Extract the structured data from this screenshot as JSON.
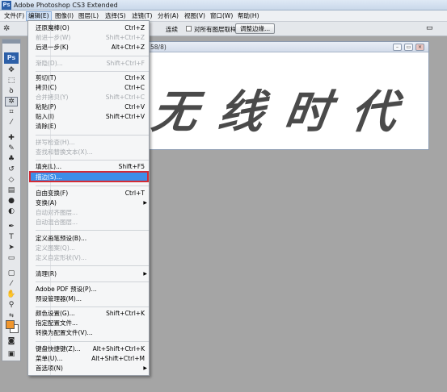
{
  "app": {
    "title": "Adobe Photoshop CS3 Extended",
    "logo": "Ps"
  },
  "menubar": [
    {
      "label": "文件(F)"
    },
    {
      "label": "编辑(E)"
    },
    {
      "label": "图像(I)"
    },
    {
      "label": "图层(L)"
    },
    {
      "label": "选择(S)"
    },
    {
      "label": "滤镜(T)"
    },
    {
      "label": "分析(A)"
    },
    {
      "label": "视图(V)"
    },
    {
      "label": "窗口(W)"
    },
    {
      "label": "帮助(H)"
    }
  ],
  "options_bar": {
    "tool_icon": "magic-wand-icon",
    "text_partial": "连续",
    "all_layers_label": "对所有图层取样",
    "refine_edge_button": "调整边缘..."
  },
  "document": {
    "title_partial": "58/8)",
    "canvas_text": "无线时代",
    "controls": {
      "minimize": "–",
      "restore": "▭",
      "close": "×"
    }
  },
  "edit_menu": {
    "items": [
      {
        "label": "还原魔棒(O)",
        "shortcut": "Ctrl+Z",
        "disabled": false,
        "submenu": false
      },
      {
        "label": "前进一步(W)",
        "shortcut": "Shift+Ctrl+Z",
        "disabled": true,
        "submenu": false
      },
      {
        "label": "后退一步(K)",
        "shortcut": "Alt+Ctrl+Z",
        "disabled": false,
        "submenu": false
      },
      {
        "label": "渐隐(D)...",
        "shortcut": "Shift+Ctrl+F",
        "disabled": true,
        "submenu": false
      },
      {
        "label": "剪切(T)",
        "shortcut": "Ctrl+X",
        "disabled": false,
        "submenu": false
      },
      {
        "label": "拷贝(C)",
        "shortcut": "Ctrl+C",
        "disabled": false,
        "submenu": false
      },
      {
        "label": "合并拷贝(Y)",
        "shortcut": "Shift+Ctrl+C",
        "disabled": true,
        "submenu": false
      },
      {
        "label": "粘贴(P)",
        "shortcut": "Ctrl+V",
        "disabled": false,
        "submenu": false
      },
      {
        "label": "贴入(I)",
        "shortcut": "Shift+Ctrl+V",
        "disabled": false,
        "submenu": false
      },
      {
        "label": "清除(E)",
        "shortcut": "",
        "disabled": false,
        "submenu": false
      },
      {
        "label": "拼写检查(H)...",
        "shortcut": "",
        "disabled": true,
        "submenu": false
      },
      {
        "label": "查找和替换文本(X)...",
        "shortcut": "",
        "disabled": true,
        "submenu": false
      },
      {
        "label": "填充(L)...",
        "shortcut": "Shift+F5",
        "disabled": false,
        "submenu": false
      },
      {
        "label": "描边(S)...",
        "shortcut": "",
        "disabled": false,
        "submenu": false,
        "highlighted": true
      },
      {
        "label": "自由变换(F)",
        "shortcut": "Ctrl+T",
        "disabled": false,
        "submenu": false
      },
      {
        "label": "变换(A)",
        "shortcut": "",
        "disabled": false,
        "submenu": true
      },
      {
        "label": "自动对齐图层...",
        "shortcut": "",
        "disabled": true,
        "submenu": false
      },
      {
        "label": "自动混合图层...",
        "shortcut": "",
        "disabled": true,
        "submenu": false
      },
      {
        "label": "定义画笔预设(B)...",
        "shortcut": "",
        "disabled": false,
        "submenu": false
      },
      {
        "label": "定义图案(Q)...",
        "shortcut": "",
        "disabled": true,
        "submenu": false
      },
      {
        "label": "定义自定形状(V)...",
        "shortcut": "",
        "disabled": true,
        "submenu": false
      },
      {
        "label": "清理(R)",
        "shortcut": "",
        "disabled": false,
        "submenu": true
      },
      {
        "label": "Adobe PDF 预设(P)...",
        "shortcut": "",
        "disabled": false,
        "submenu": false
      },
      {
        "label": "预设管理器(M)...",
        "shortcut": "",
        "disabled": false,
        "submenu": false
      },
      {
        "label": "颜色设置(G)...",
        "shortcut": "Shift+Ctrl+K",
        "disabled": false,
        "submenu": false
      },
      {
        "label": "指定配置文件...",
        "shortcut": "",
        "disabled": false,
        "submenu": false
      },
      {
        "label": "转换为配置文件(V)...",
        "shortcut": "",
        "disabled": false,
        "submenu": false
      },
      {
        "label": "键盘快捷键(Z)...",
        "shortcut": "Alt+Shift+Ctrl+K",
        "disabled": false,
        "submenu": false
      },
      {
        "label": "菜单(U)...",
        "shortcut": "Alt+Shift+Ctrl+M",
        "disabled": false,
        "submenu": false
      },
      {
        "label": "首选项(N)",
        "shortcut": "",
        "disabled": false,
        "submenu": true
      }
    ]
  },
  "toolbox": {
    "tools": [
      "move-icon",
      "marquee-icon",
      "lasso-icon",
      "magic-wand-icon",
      "crop-icon",
      "eyedropper-icon",
      "healing-brush-icon",
      "brush-icon",
      "clone-stamp-icon",
      "history-brush-icon",
      "eraser-icon",
      "gradient-icon",
      "blur-icon",
      "dodge-icon",
      "pen-icon",
      "type-icon",
      "path-selection-icon",
      "shape-icon",
      "notes-icon",
      "eyedropper2-icon",
      "hand-icon",
      "zoom-icon"
    ],
    "colors": {
      "foreground": "#f0962d",
      "background": "#ffffff"
    }
  },
  "colors": {
    "menu_highlight": "#3d8ee8",
    "callout_border": "#d22a35"
  }
}
